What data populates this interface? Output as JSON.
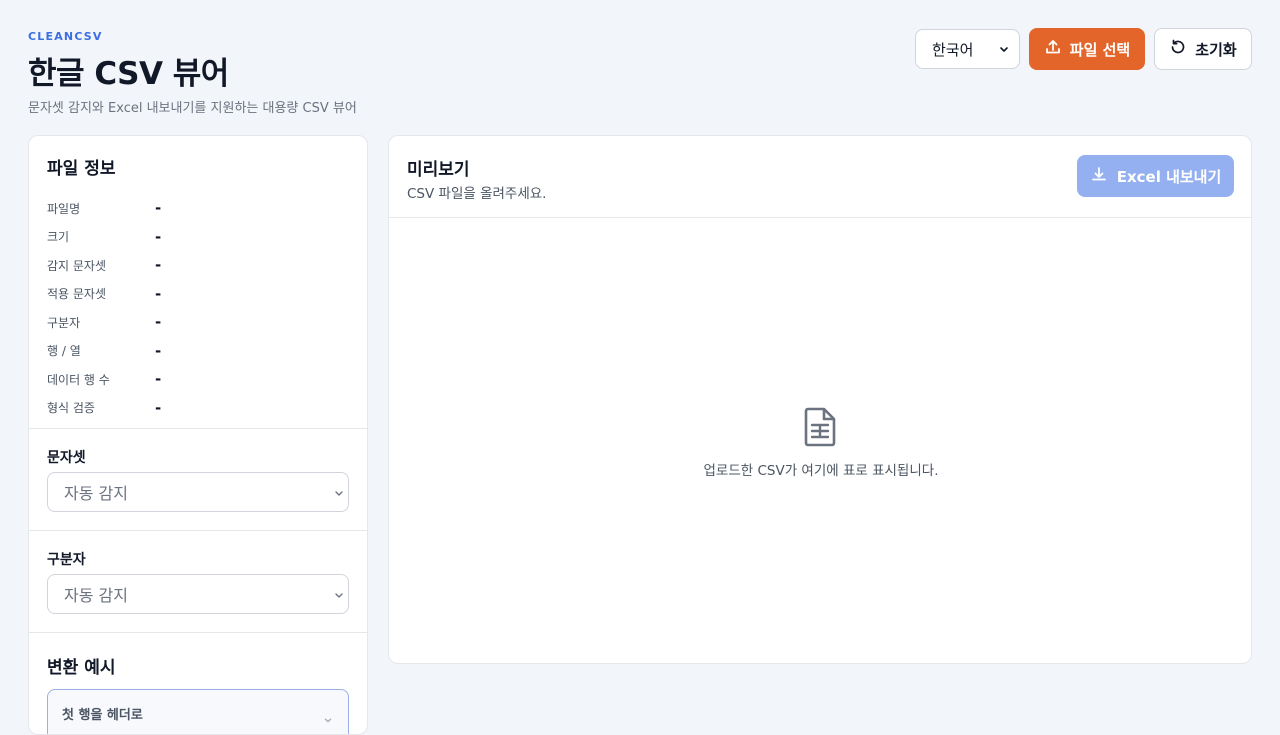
{
  "header": {
    "brand": "CLEANCSV",
    "title": "한글 CSV 뷰어",
    "subtitle": "문자셋 감지와 Excel 내보내기를 지원하는 대용량 CSV 뷰어"
  },
  "toolbar": {
    "language_value": "한국어",
    "file_button_label": "파일 선택",
    "reset_button_label": "초기화"
  },
  "file_info": {
    "title": "파일 정보",
    "rows": [
      {
        "label": "파일명",
        "value": "-"
      },
      {
        "label": "크기",
        "value": "-"
      },
      {
        "label": "감지 문자셋",
        "value": "-"
      },
      {
        "label": "적용 문자셋",
        "value": "-"
      },
      {
        "label": "구분자",
        "value": "-"
      },
      {
        "label": "행 / 열",
        "value": "-"
      },
      {
        "label": "데이터 행 수",
        "value": "-"
      },
      {
        "label": "형식 검증",
        "value": "-"
      }
    ]
  },
  "charset": {
    "label": "문자셋",
    "value": "자동 감지"
  },
  "delimiter": {
    "label": "구분자",
    "value": "자동 감지"
  },
  "example": {
    "title": "변환 예시",
    "option": "첫 행을 헤더로"
  },
  "preview": {
    "title": "미리보기",
    "subtitle": "CSV 파일을 올려주세요.",
    "export_label": "Excel 내보내기",
    "empty_message": "업로드한 CSV가 여기에 표로 표시됩니다."
  },
  "colors": {
    "background": "#f2f5f9",
    "brand": "#3b6fe3",
    "primary_button": "#e3652a",
    "export_button_disabled": "#94b0f0"
  },
  "icons": {
    "file_button": "upload-icon",
    "reset_button": "refresh-icon",
    "export_button": "download-icon",
    "empty_state": "spreadsheet-file-icon"
  }
}
